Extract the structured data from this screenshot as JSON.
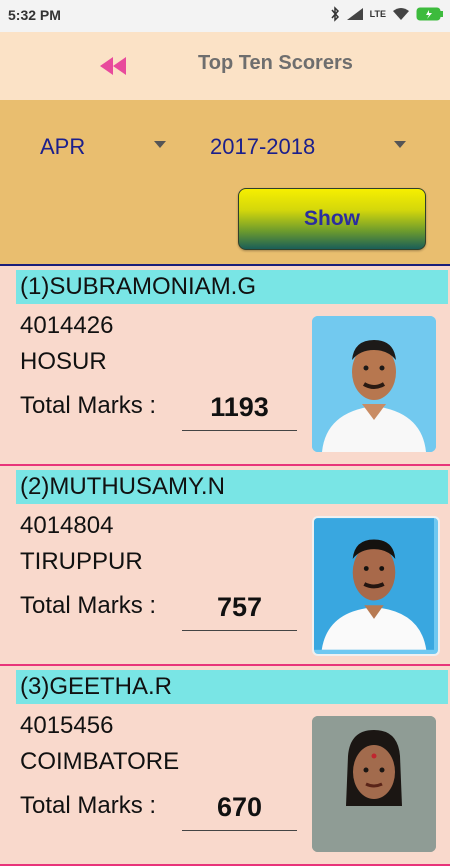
{
  "status_bar": {
    "time": "5:32 PM",
    "network_label": "LTE"
  },
  "header": {
    "title": "Top Ten Scorers"
  },
  "filters": {
    "month": "APR",
    "year": "2017-2018",
    "show_label": "Show"
  },
  "scorers": [
    {
      "name": "(1)SUBRAMONIAM.G",
      "id": "4014426",
      "city": "HOSUR",
      "marks_label": "Total Marks :",
      "marks": "1193"
    },
    {
      "name": "(2)MUTHUSAMY.N",
      "id": "4014804",
      "city": "TIRUPPUR",
      "marks_label": "Total Marks :",
      "marks": "757"
    },
    {
      "name": "(3)GEETHA.R",
      "id": "4015456",
      "city": "COIMBATORE",
      "marks_label": "Total Marks :",
      "marks": "670"
    }
  ]
}
